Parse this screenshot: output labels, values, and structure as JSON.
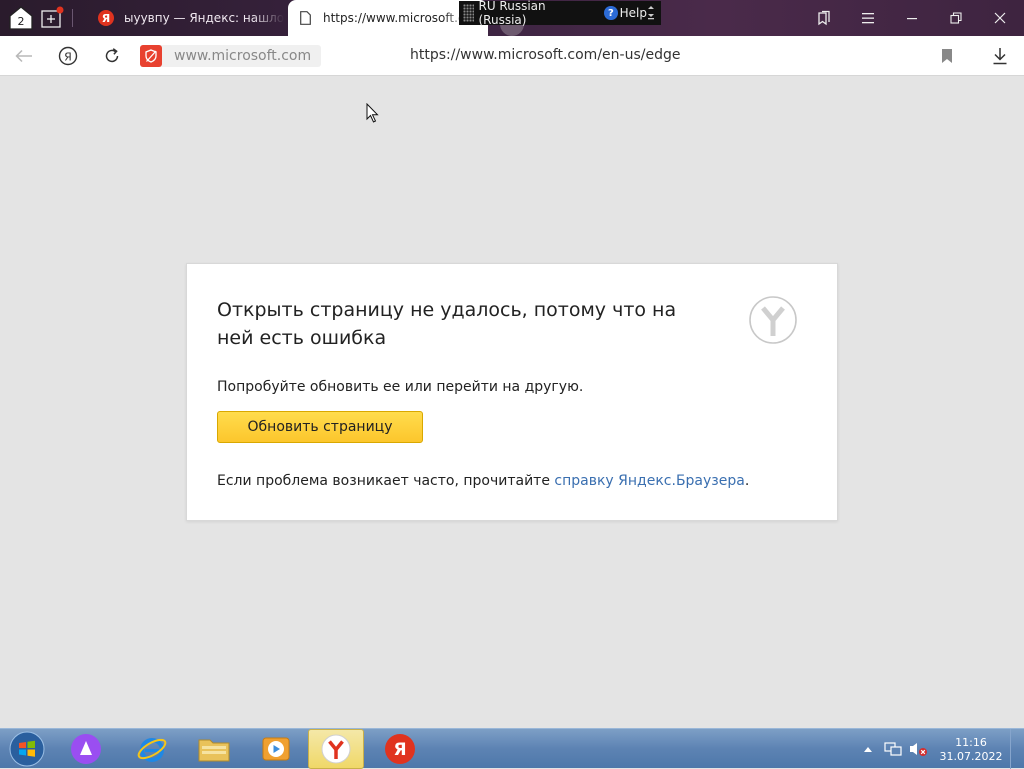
{
  "browser": {
    "tab_count": "2",
    "tabs": [
      {
        "title": "ыуувпу — Яндекс: нашлось",
        "favicon": "Я"
      },
      {
        "title": "https://www.microsoft.com/en-us/edge",
        "active": true
      }
    ]
  },
  "language_bar": {
    "language": "RU Russian (Russia)",
    "help_icon": "?",
    "help_label": "Help"
  },
  "address_bar": {
    "site_chip": "www.microsoft.com",
    "url": "https://www.microsoft.com/en-us/edge"
  },
  "error_page": {
    "title": "Открыть страницу не удалось, потому что на ней есть ошибка",
    "hint": "Попробуйте обновить ее или перейти на другую.",
    "reload_button": "Обновить страницу",
    "footer_text": "Если проблема возникает часто, прочитайте ",
    "footer_link": "справку Яндекс.Браузера",
    "footer_end": "."
  },
  "taskbar": {
    "items": [
      "start-orb-icon",
      "alice-icon",
      "internet-explorer-icon",
      "file-explorer-icon",
      "media-player-icon",
      "yandex-browser-icon",
      "yandex-icon"
    ],
    "time": "11:16",
    "date": "31.07.2022"
  },
  "colors": {
    "accent_button": "#fcc62c",
    "link": "#3a6fb0",
    "yandex_red": "#e0331f"
  }
}
